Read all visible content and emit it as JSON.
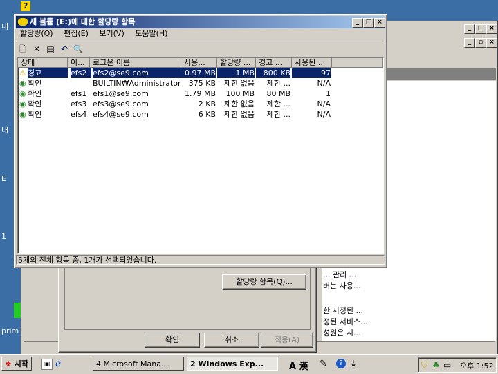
{
  "dialog": {
    "title": "새 볼륨 (E:)에 대한 할당량 항목",
    "menu": [
      "할당량(Q)",
      "편집(E)",
      "보기(V)",
      "도움말(H)"
    ],
    "columns": [
      "상태",
      "이...",
      "로그온 이름",
      "사용...",
      "할당량 ...",
      "경고 ...",
      "사용된 ..."
    ],
    "rows": [
      {
        "status": "경고",
        "icon": "warning-icon",
        "name": "efs2",
        "logon": "efs2@se9.com",
        "used": "0.97 MB",
        "limit": "1 MB",
        "warn": "800 KB",
        "pct": "97",
        "selected": true
      },
      {
        "status": "확인",
        "icon": "ok-icon",
        "name": "",
        "logon": "BUILTIN₩Administrators",
        "used": "375 KB",
        "limit": "제한 없음",
        "warn": "제한 ...",
        "pct": "N/A",
        "selected": false
      },
      {
        "status": "확인",
        "icon": "ok-icon",
        "name": "efs1",
        "logon": "efs1@se9.com",
        "used": "1.79 MB",
        "limit": "100 MB",
        "warn": "80 MB",
        "pct": "1",
        "selected": false
      },
      {
        "status": "확인",
        "icon": "ok-icon",
        "name": "efs3",
        "logon": "efs3@se9.com",
        "used": "2 KB",
        "limit": "제한 없음",
        "warn": "제한 ...",
        "pct": "N/A",
        "selected": false
      },
      {
        "status": "확인",
        "icon": "ok-icon",
        "name": "efs4",
        "logon": "efs4@se9.com",
        "used": "6 KB",
        "limit": "제한 없음",
        "warn": "제한 ...",
        "pct": "N/A",
        "selected": false
      }
    ],
    "statusbar": "5개의 전체 항목 중, 1개가 선택되었습니다."
  },
  "props": {
    "quota_button": "할당량 항목(Q)...",
    "ok": "확인",
    "cancel": "취소",
    "apply": "적용(A)"
  },
  "bg_window": {
    "right_texts": [
      "... 관리 ...",
      "버는 사용...",
      "한 지정된 ...",
      "정된 서비스...",
      "성원은 시..."
    ]
  },
  "desktop": {
    "left_labels": [
      "내",
      "내",
      "E",
      "1",
      "prim"
    ]
  },
  "taskbar": {
    "start": "시작",
    "tasks": [
      "4 Microsoft Mana...",
      "2 Windows Exp..."
    ],
    "ime": "A 漢",
    "clock": "오후 1:52"
  }
}
